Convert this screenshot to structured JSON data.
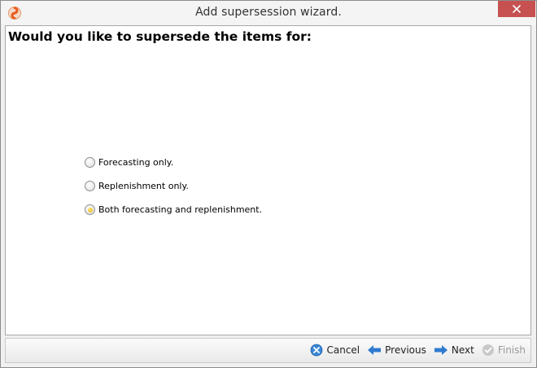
{
  "window": {
    "title": "Add supersession wizard."
  },
  "main": {
    "heading": "Would you like to supersede the items for:",
    "options": [
      {
        "label": "Forecasting only.",
        "selected": false
      },
      {
        "label": "Replenishment only.",
        "selected": false
      },
      {
        "label": "Both forecasting and replenishment.",
        "selected": true
      }
    ]
  },
  "footer": {
    "buttons": [
      {
        "label": "Cancel",
        "icon": "cancel-icon",
        "enabled": true
      },
      {
        "label": "Previous",
        "icon": "arrow-left-icon",
        "enabled": true
      },
      {
        "label": "Next",
        "icon": "arrow-right-icon",
        "enabled": true
      },
      {
        "label": "Finish",
        "icon": "check-icon",
        "enabled": false
      }
    ]
  },
  "colors": {
    "close_button": "#c75050",
    "radio_selected": "#e9b600",
    "icon_blue": "#2f7bd0",
    "disabled_text": "#9a9a9a"
  }
}
